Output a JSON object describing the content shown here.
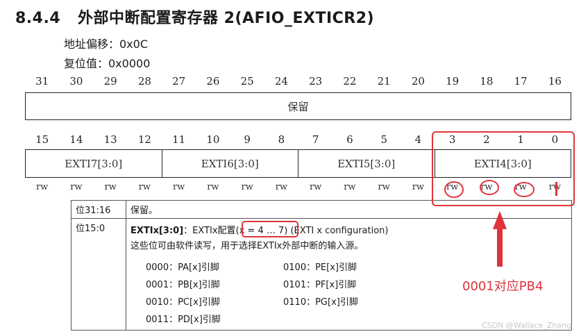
{
  "heading": {
    "number": "8.4.4",
    "title": "外部中断配置寄存器 2(AFIO_EXTICR2)"
  },
  "offset": "地址偏移：0x0C",
  "reset": "复位值：0x0000",
  "upper_bits": [
    "31",
    "30",
    "29",
    "28",
    "27",
    "26",
    "25",
    "24",
    "23",
    "22",
    "21",
    "20",
    "19",
    "18",
    "17",
    "16"
  ],
  "upper_field": "保留",
  "lower_bits": [
    "15",
    "14",
    "13",
    "12",
    "11",
    "10",
    "9",
    "8",
    "7",
    "6",
    "5",
    "4",
    "3",
    "2",
    "1",
    "0"
  ],
  "lower_fields": [
    "EXTI7[3:0]",
    "EXTI6[3:0]",
    "EXTI5[3:0]",
    "EXTI4[3:0]"
  ],
  "access": [
    "rw",
    "rw",
    "rw",
    "rw",
    "rw",
    "rw",
    "rw",
    "rw",
    "rw",
    "rw",
    "rw",
    "rw",
    "rw",
    "rw",
    "rw",
    "rw"
  ],
  "desc": {
    "row1": {
      "bits": "位31:16",
      "text": "保留。"
    },
    "row2": {
      "bits": "位15:0",
      "name": "EXTIx[3:0]",
      "name_suffix": "：EXTIx配置(",
      "range": "x = 4 … 7",
      "config": ") (EXTI x configuration)",
      "body": "这些位可由软件读写，用于选择EXTIx外部中断的输入源。",
      "sources": [
        "0000：PA[x]引脚",
        "0100：PE[x]引脚",
        "0001：PB[x]引脚",
        "0101：PF[x]引脚",
        "0010：PC[x]引脚",
        "0110：PG[x]引脚",
        "0011：PD[x]引脚",
        ""
      ]
    }
  },
  "annotation": "0001对应PB4",
  "watermark": "CSDN @Wallace_Zhang",
  "colors": {
    "annotation": "#e0333a",
    "text": "#1a1a1a"
  }
}
